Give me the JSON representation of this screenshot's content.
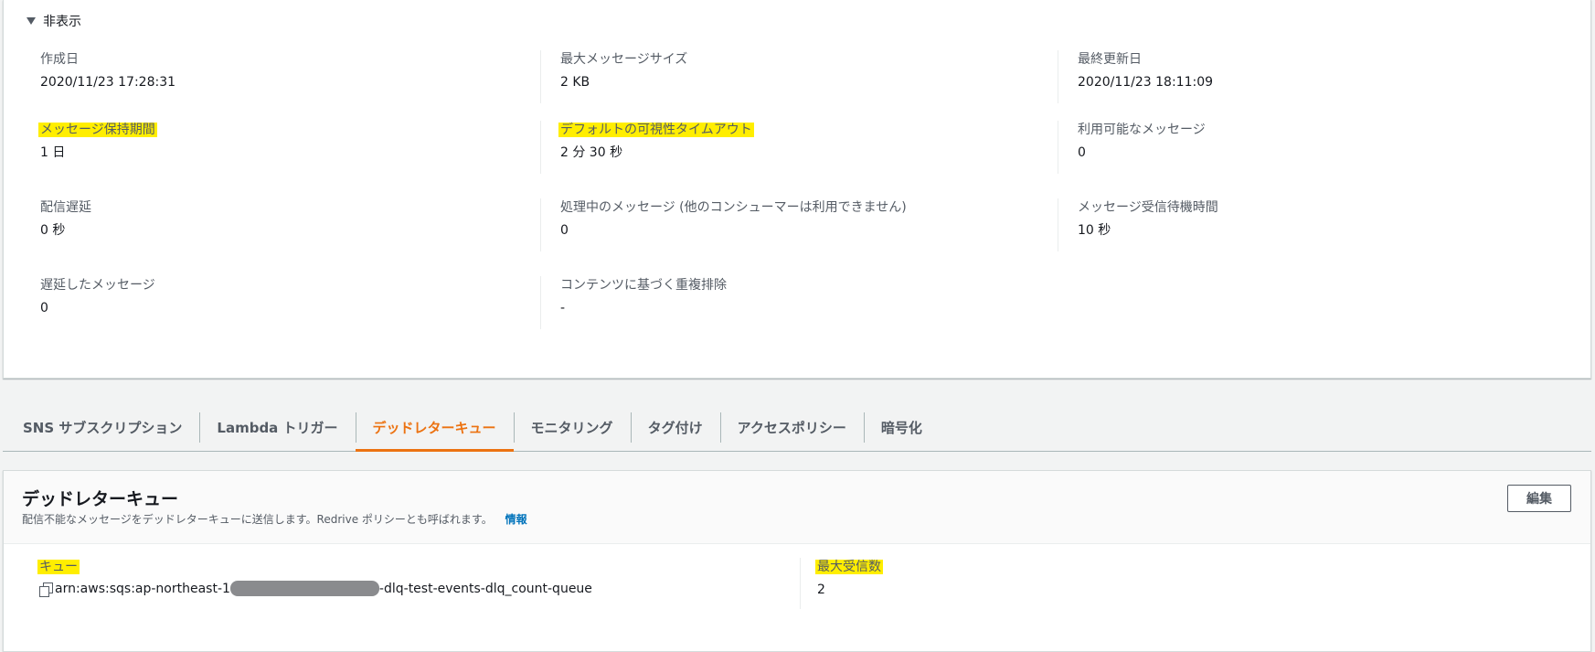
{
  "details": {
    "toggle_label": "非表示",
    "rows": [
      [
        {
          "label": "作成日",
          "value": "2020/11/23 17:28:31",
          "highlight": false
        },
        {
          "label": "最大メッセージサイズ",
          "value": "2 KB",
          "highlight": false
        },
        {
          "label": "最終更新日",
          "value": "2020/11/23 18:11:09",
          "highlight": false
        }
      ],
      [
        {
          "label": "メッセージ保持期間",
          "value": "1 日",
          "highlight": true
        },
        {
          "label": "デフォルトの可視性タイムアウト",
          "value": "2 分 30 秒",
          "highlight": true
        },
        {
          "label": "利用可能なメッセージ",
          "value": "0",
          "highlight": false
        }
      ],
      [
        {
          "label": "配信遅延",
          "value": "0 秒",
          "highlight": false
        },
        {
          "label": "処理中のメッセージ (他のコンシューマーは利用できません)",
          "value": "0",
          "highlight": false
        },
        {
          "label": "メッセージ受信待機時間",
          "value": "10 秒",
          "highlight": false
        }
      ],
      [
        {
          "label": "遅延したメッセージ",
          "value": "0",
          "highlight": false
        },
        {
          "label": "コンテンツに基づく重複排除",
          "value": "-",
          "highlight": false
        }
      ]
    ]
  },
  "tabs": [
    {
      "label": "SNS サブスクリプション",
      "active": false
    },
    {
      "label": "Lambda トリガー",
      "active": false
    },
    {
      "label": "デッドレターキュー",
      "active": true
    },
    {
      "label": "モニタリング",
      "active": false
    },
    {
      "label": "タグ付け",
      "active": false
    },
    {
      "label": "アクセスポリシー",
      "active": false
    },
    {
      "label": "暗号化",
      "active": false
    }
  ],
  "dlq": {
    "title": "デッドレターキュー",
    "description": "配信不能なメッセージをデッドレターキューに送信します。Redrive ポリシーとも呼ばれます。",
    "info_link": "情報",
    "edit_button": "編集",
    "queue_label": "キュー",
    "queue_arn_prefix": "arn:aws:sqs:ap-northeast-1",
    "queue_arn_suffix": "-dlq-test-events-dlq_count-queue",
    "max_receives_label": "最大受信数",
    "max_receives_value": "2"
  },
  "colors": {
    "highlight": "#ffee00",
    "active_tab": "#ec7211",
    "link": "#0073bb",
    "redaction": "#8a8b8e"
  },
  "icons": {
    "toggle": "caret-down-icon",
    "copy": "copy-icon"
  }
}
